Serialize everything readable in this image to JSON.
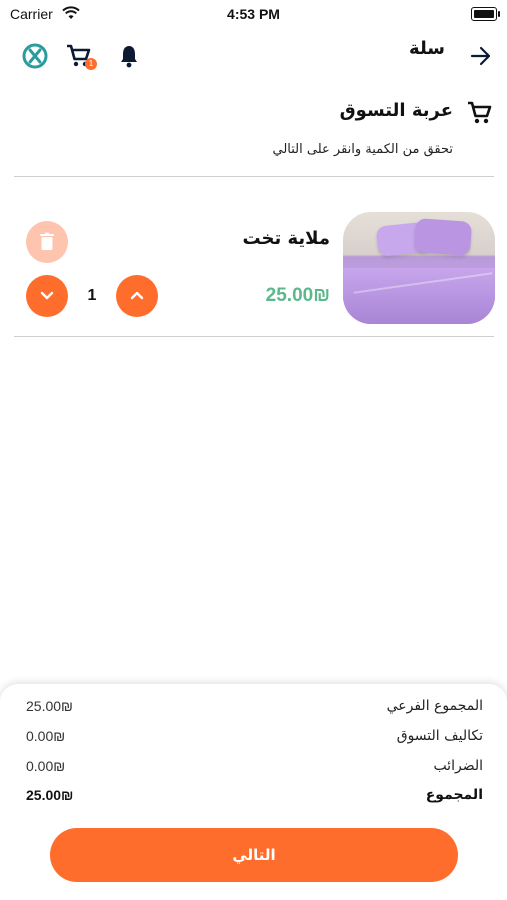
{
  "status_bar": {
    "carrier": "Carrier",
    "time": "4:53 PM"
  },
  "app_bar": {
    "title": "سلة",
    "cart_badge": "1"
  },
  "section": {
    "title": "عربة التسوق",
    "subtitle": "تحقق من الكمية وانقر على التالي"
  },
  "cart": {
    "items": [
      {
        "name": "ملاية تخت",
        "price": "25.00₪",
        "quantity": "1"
      }
    ]
  },
  "summary": {
    "rows": [
      {
        "label": "المجموع الفرعي",
        "value": "25.00₪"
      },
      {
        "label": "تكاليف التسوق",
        "value": "0.00₪"
      },
      {
        "label": "الضرائب",
        "value": "0.00₪"
      },
      {
        "label": "المجموع",
        "value": "25.00₪"
      }
    ]
  },
  "actions": {
    "next_label": "التالي"
  },
  "colors": {
    "accent": "#ff6d2d",
    "accent_light": "#ffc4ad",
    "price": "#5cb88a",
    "logo_teal": "#2b9c9c"
  }
}
